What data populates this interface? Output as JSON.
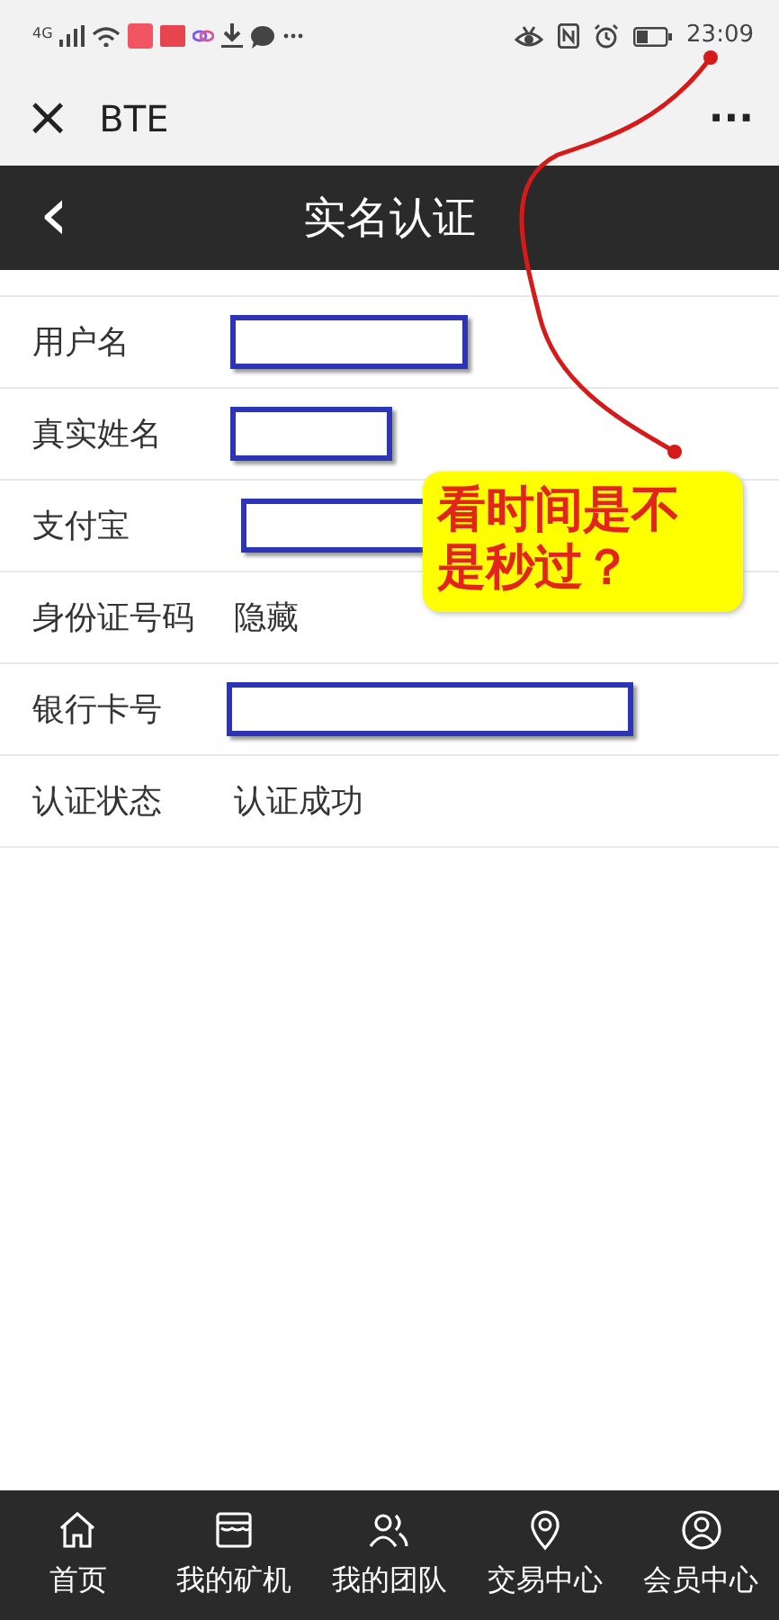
{
  "status_bar": {
    "network": "4G",
    "time": "23:09"
  },
  "title_bar": {
    "close": "×",
    "title": "BTE",
    "more": "···"
  },
  "header": {
    "back": "‹",
    "title": "实名认证"
  },
  "rows": [
    {
      "label": "用户名",
      "kind": "redacted"
    },
    {
      "label": "真实姓名",
      "kind": "redacted"
    },
    {
      "label": "支付宝",
      "kind": "redacted"
    },
    {
      "label": "身份证号码",
      "kind": "text",
      "value": "隐藏"
    },
    {
      "label": "银行卡号",
      "kind": "redacted"
    },
    {
      "label": "认证状态",
      "kind": "text",
      "value": "认证成功"
    }
  ],
  "annotation": {
    "text": "看时间是不是秒过？"
  },
  "bottom_nav": [
    {
      "label": "首页"
    },
    {
      "label": "我的矿机"
    },
    {
      "label": "我的团队"
    },
    {
      "label": "交易中心"
    },
    {
      "label": "会员中心"
    }
  ]
}
